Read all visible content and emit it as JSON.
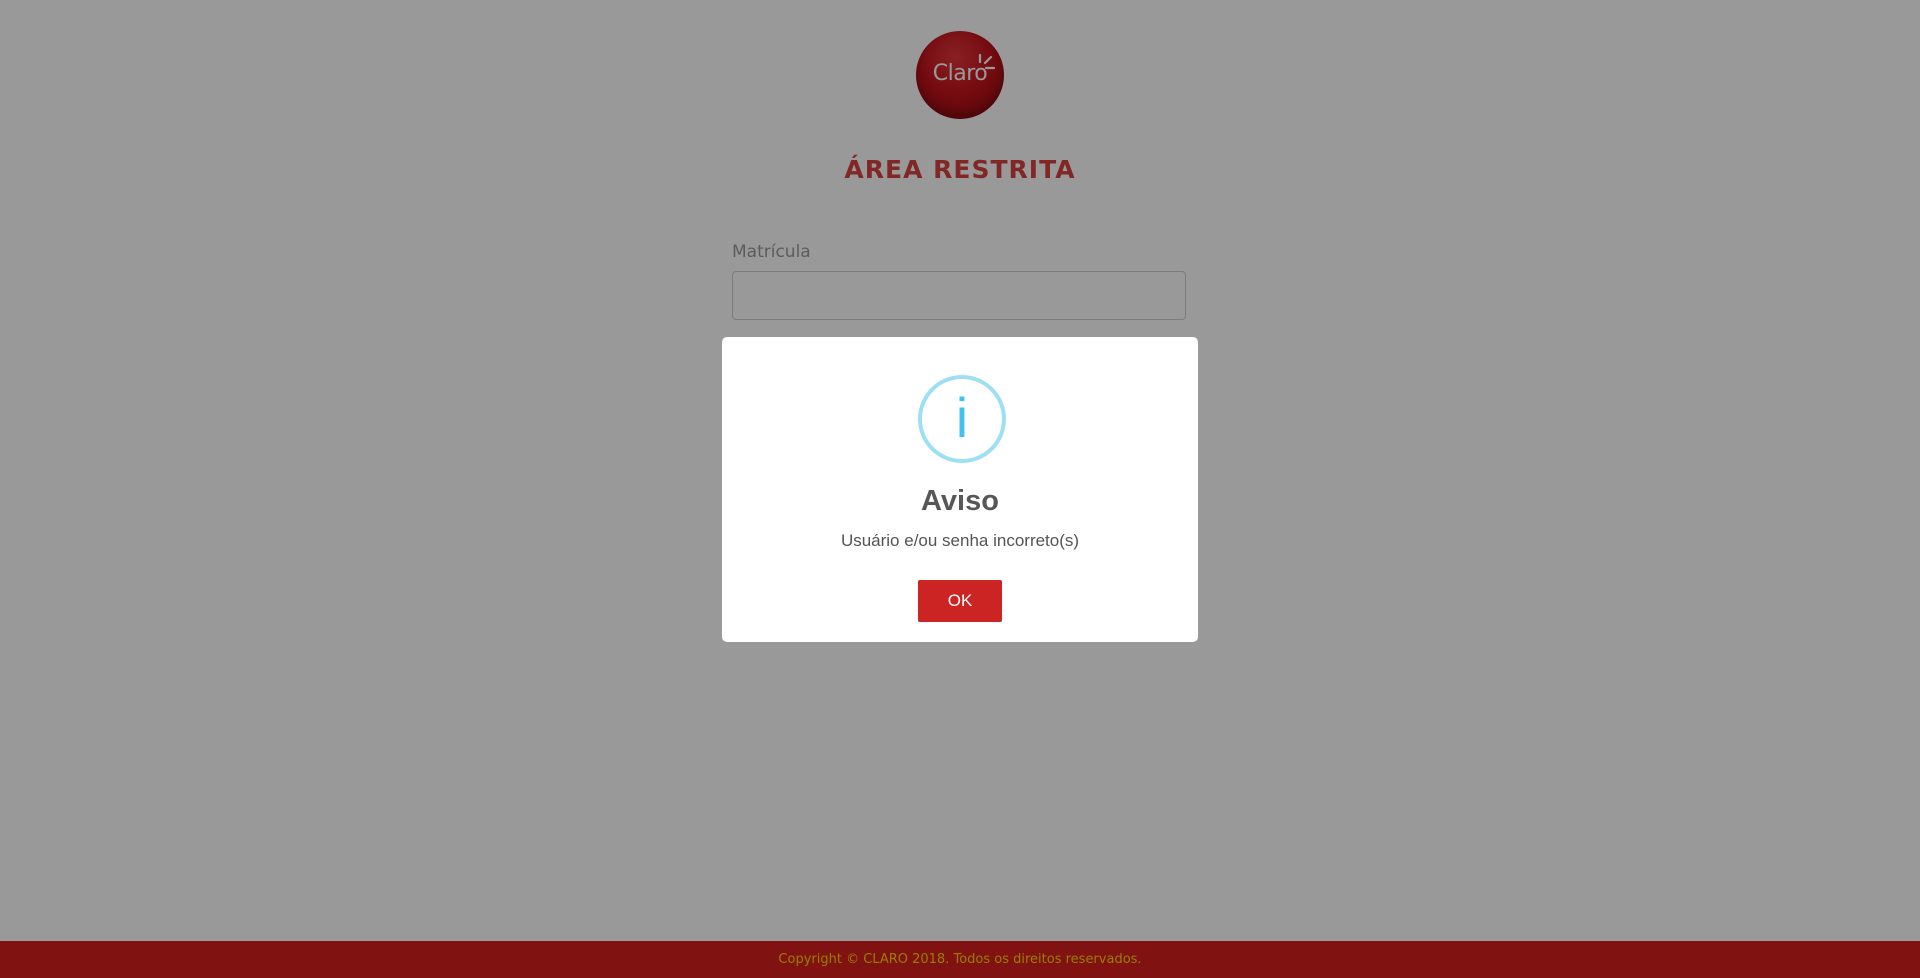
{
  "page": {
    "logo_text": "Claro",
    "title": "ÁREA RESTRITA",
    "field_label": "Matrícula",
    "field_value": "",
    "footer_text": "Copyright © CLARO 2018. Todos os direitos reservados."
  },
  "modal": {
    "icon": "info-icon",
    "icon_glyph": "i",
    "title": "Aviso",
    "message": "Usuário e/ou senha incorreto(s)",
    "ok_label": "OK"
  },
  "colors": {
    "brand_red": "#d61f1f",
    "title_red": "#d8413f",
    "footer_text": "#ffd000",
    "info_blue": "#3fc3ee",
    "info_ring": "#9de0f6",
    "button_red": "#cc2323"
  }
}
